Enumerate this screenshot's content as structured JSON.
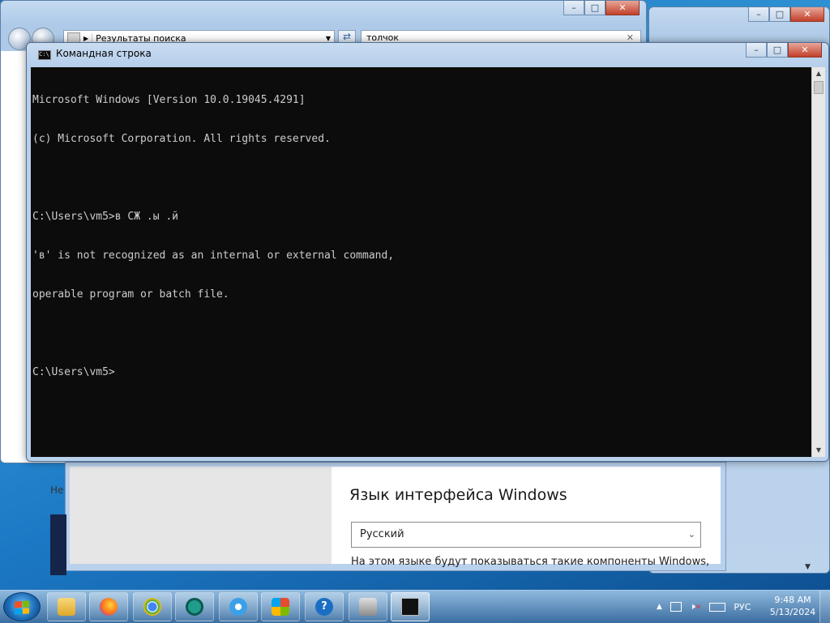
{
  "explorer": {
    "address_crumb": "Результаты поиска",
    "search_value": "толчок",
    "left_fragment": "Не"
  },
  "cmd": {
    "title": "Командная строка",
    "lines": [
      "Microsoft Windows [Version 10.0.19045.4291]",
      "(c) Microsoft Corporation. All rights reserved.",
      "",
      "C:\\Users\\vm5>в СЖ .ы .й",
      "'в' is not recognized as an internal or external command,",
      "operable program or batch file.",
      "",
      "C:\\Users\\vm5>"
    ]
  },
  "settings": {
    "lang_title": "Язык интерфейса Windows",
    "lang_selected": "Русский",
    "lang_desc": "На этом языке будут показываться такие компоненты Windows,"
  },
  "taskbar": {
    "apps": [
      {
        "name": "file-explorer",
        "color": "#f0c24a"
      },
      {
        "name": "firefox",
        "color": "#ff7a1a"
      },
      {
        "name": "chrome",
        "color": "#4285f4"
      },
      {
        "name": "camo",
        "color": "#1f9d8a"
      },
      {
        "name": "settings",
        "color": "#3aa0e8"
      },
      {
        "name": "windows-update",
        "color": "#e84b2f"
      },
      {
        "name": "help",
        "color": "#1a6fc4"
      },
      {
        "name": "remote",
        "color": "#c9c9c9"
      },
      {
        "name": "command-prompt",
        "color": "#111111"
      }
    ],
    "tray_lang": "РУС",
    "time": "9:48 AM",
    "date": "5/13/2024"
  }
}
